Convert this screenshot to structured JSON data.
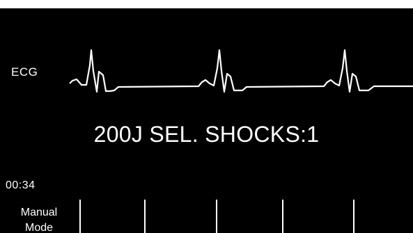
{
  "display": {
    "lead_label": "ECG",
    "status_message": "200J SEL. SHOCKS:1",
    "elapsed_time": "00:34",
    "background_color": "#000000",
    "foreground_color": "#ffffff"
  },
  "softkeys": [
    {
      "label_line1": "Manual",
      "label_line2": "Mode"
    },
    {
      "label_line1": "",
      "label_line2": ""
    },
    {
      "label_line1": "",
      "label_line2": ""
    },
    {
      "label_line1": "",
      "label_line2": ""
    },
    {
      "label_line1": "",
      "label_line2": ""
    },
    {
      "label_line1": "",
      "label_line2": ""
    }
  ]
}
